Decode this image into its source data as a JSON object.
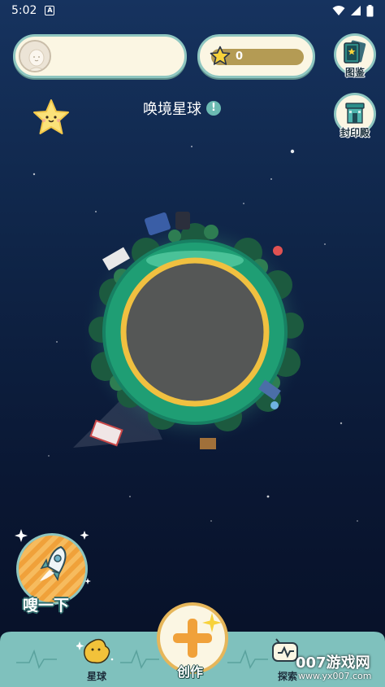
{
  "status_bar": {
    "time": "5:02"
  },
  "top": {
    "star_count": "0"
  },
  "side_buttons": {
    "gallery_label": "图鉴",
    "seal_label": "封印殿"
  },
  "planet": {
    "name": "唤境星球",
    "info_glyph": "!"
  },
  "actions": {
    "whoosh_label": "嗖一下"
  },
  "nav": {
    "planet_label": "星球",
    "create_label": "创作",
    "explore_label": "探索"
  },
  "watermark": {
    "brand": "007游戏网",
    "url": "www.yx007.com"
  },
  "colors": {
    "teal": "#8ec6c0",
    "cream": "#fbf6e3",
    "gold": "#e6b65a",
    "orange": "#f0a13a",
    "planet_green": "#23a879"
  },
  "icons": [
    "wifi-icon",
    "signal-icon",
    "battery-icon",
    "user-avatar-icon",
    "star-icon",
    "gallery-card-icon",
    "temple-icon",
    "rocket-icon",
    "plus-icon",
    "planet-blob-icon",
    "explore-tv-icon"
  ]
}
